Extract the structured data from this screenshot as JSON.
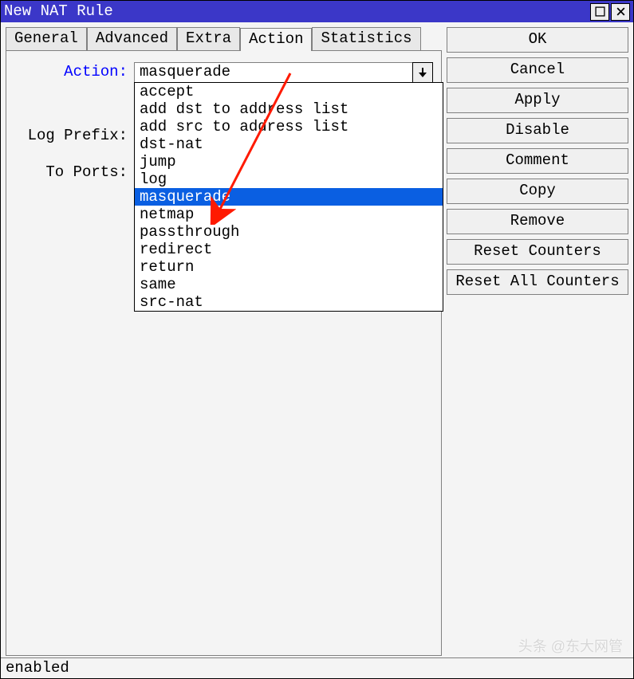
{
  "window": {
    "title": "New NAT Rule"
  },
  "tabs": {
    "items": [
      "General",
      "Advanced",
      "Extra",
      "Action",
      "Statistics"
    ],
    "activeIndex": 3
  },
  "form": {
    "action_label": "Action:",
    "action_value": "masquerade",
    "log_prefix_label": "Log Prefix:",
    "to_ports_label": "To Ports:"
  },
  "dropdown": {
    "options": [
      "accept",
      "add dst to address list",
      "add src to address list",
      "dst-nat",
      "jump",
      "log",
      "masquerade",
      "netmap",
      "passthrough",
      "redirect",
      "return",
      "same",
      "src-nat"
    ],
    "selectedIndex": 6
  },
  "buttons": {
    "ok": "OK",
    "cancel": "Cancel",
    "apply": "Apply",
    "disable": "Disable",
    "comment": "Comment",
    "copy": "Copy",
    "remove": "Remove",
    "reset_counters": "Reset Counters",
    "reset_all_counters": "Reset All Counters"
  },
  "status": {
    "text": "enabled"
  },
  "annotation": {
    "highlight_option": "masquerade",
    "watermark": "头条 @东大网管"
  }
}
